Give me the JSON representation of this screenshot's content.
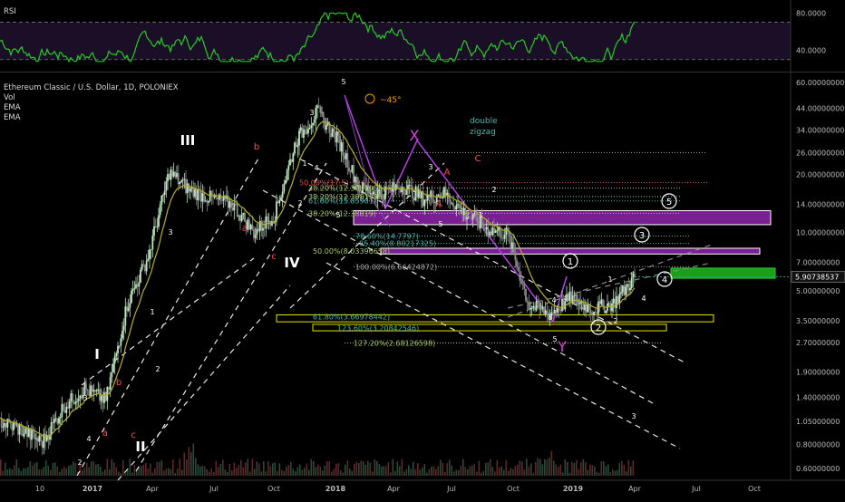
{
  "legend": {
    "title": "Ethereum Classic / U.S. Dollar, 1D, POLONIEX",
    "studies": [
      "Vol",
      "EMA",
      "EMA"
    ]
  },
  "rsi": {
    "label": "RSI",
    "axis_ticks": [
      "80.0000",
      "40.0000"
    ],
    "band": [
      30,
      70
    ],
    "range": [
      20,
      90
    ]
  },
  "price_axis": {
    "ticks": [
      "60.00000000",
      "44.00000000",
      "34.00000000",
      "26.00000000",
      "20.00000000",
      "14.00000000",
      "10.00000000",
      "7.00000000",
      "5.00000000",
      "3.50000000",
      "2.70000000",
      "1.90000000",
      "1.40000000",
      "1.05000000",
      "0.80000000",
      "0.60000000"
    ],
    "last_price": "5.90738537",
    "last_price_color": "#26a69a"
  },
  "time_axis": [
    "10",
    "2017",
    "Apr",
    "Jul",
    "Oct",
    "2018",
    "Apr",
    "Jul",
    "Oct",
    "2019",
    "Apr",
    "Jul",
    "Oct"
  ],
  "fib_labels": [
    {
      "text": "38.20%(12.3881955)",
      "price": 17.0,
      "color": "#a8c86a"
    },
    {
      "text": "50.00%(17.5)",
      "price": 18.2,
      "color": "#e05050"
    },
    {
      "text": "38.20%(12.3881955)",
      "price": 15.4,
      "color": "#a8c86a"
    },
    {
      "text": "61.80%(15.85901)",
      "price": 14.6,
      "color": "#4db6ac"
    },
    {
      "text": "38.20%(12.38819)",
      "price": 12.6,
      "color": "#a8c86a"
    },
    {
      "text": "78.60%(14.7797)",
      "price": 9.6,
      "color": "#4db6ac"
    },
    {
      "text": "85.40%(8.80217325)",
      "price": 8.8,
      "color": "#4db6ac"
    },
    {
      "text": "50.00%(8.03396658)",
      "price": 8.03,
      "color": "#a8c86a"
    },
    {
      "text": "100.00%(6.66424872)",
      "price": 6.66,
      "color": "#aaaaaa"
    },
    {
      "text": "61.80%(3.66978442)",
      "price": 3.67,
      "color": "#4db6ac"
    },
    {
      "text": "123.60%(3.20842546)",
      "price": 3.21,
      "color": "#4db6ac"
    },
    {
      "text": "127.20%(2.68126598)",
      "price": 2.68,
      "color": "#a8c86a"
    }
  ],
  "annotations": {
    "double_zigzag": [
      "double",
      "zigzag"
    ],
    "angle": "~45°",
    "waves": [
      "III",
      "IV",
      "II",
      "I",
      "X",
      "Y",
      "5",
      "3",
      "1",
      "2",
      "4",
      "a",
      "b",
      "c",
      "A",
      "C"
    ]
  },
  "chart_data": {
    "type": "line",
    "title": "Ethereum Classic / U.S. Dollar, 1D, POLONIEX",
    "y_scale": "log",
    "ylim": [
      0.55,
      62
    ],
    "x": [
      "2016-10",
      "2016-11",
      "2016-12",
      "2017-01",
      "2017-02",
      "2017-03",
      "2017-04",
      "2017-05",
      "2017-06",
      "2017-07",
      "2017-08",
      "2017-09",
      "2017-10",
      "2017-11",
      "2017-12",
      "2018-01",
      "2018-02",
      "2018-03",
      "2018-04",
      "2018-05",
      "2018-06",
      "2018-07",
      "2018-08",
      "2018-09",
      "2018-10",
      "2018-11",
      "2018-12",
      "2019-01",
      "2019-02",
      "2019-03",
      "2019-04"
    ],
    "series": [
      {
        "values": [
          1.05,
          0.95,
          0.82,
          1.25,
          1.55,
          1.35,
          4.2,
          7.5,
          20.5,
          16.5,
          15.0,
          14.0,
          10.0,
          12.5,
          30.0,
          42.0,
          30.0,
          17.0,
          16.0,
          17.5,
          15.0,
          16.0,
          12.5,
          10.5,
          9.8,
          4.2,
          3.8,
          4.6,
          4.0,
          4.3,
          5.9
        ]
      }
    ],
    "grid": false,
    "legend": "top-left"
  }
}
